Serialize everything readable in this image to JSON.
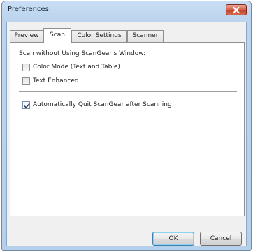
{
  "window": {
    "title": "Preferences"
  },
  "tabs": [
    {
      "label": "Preview",
      "active": false
    },
    {
      "label": "Scan",
      "active": true
    },
    {
      "label": "Color Settings",
      "active": false
    },
    {
      "label": "Scanner",
      "active": false
    }
  ],
  "scan_panel": {
    "group_label": "Scan without Using ScanGear's Window:",
    "options": [
      {
        "label": "Color Mode (Text and Table)",
        "checked": false
      },
      {
        "label": "Text Enhanced",
        "checked": false
      }
    ],
    "auto_quit": {
      "label": "Automatically Quit ScanGear after Scanning",
      "checked": true
    }
  },
  "buttons": {
    "ok_label": "OK",
    "cancel_label": "Cancel"
  },
  "colors": {
    "close_button": "#c0402a",
    "titlebar": "#c9def4",
    "default_button_border": "#3c7fb1"
  }
}
